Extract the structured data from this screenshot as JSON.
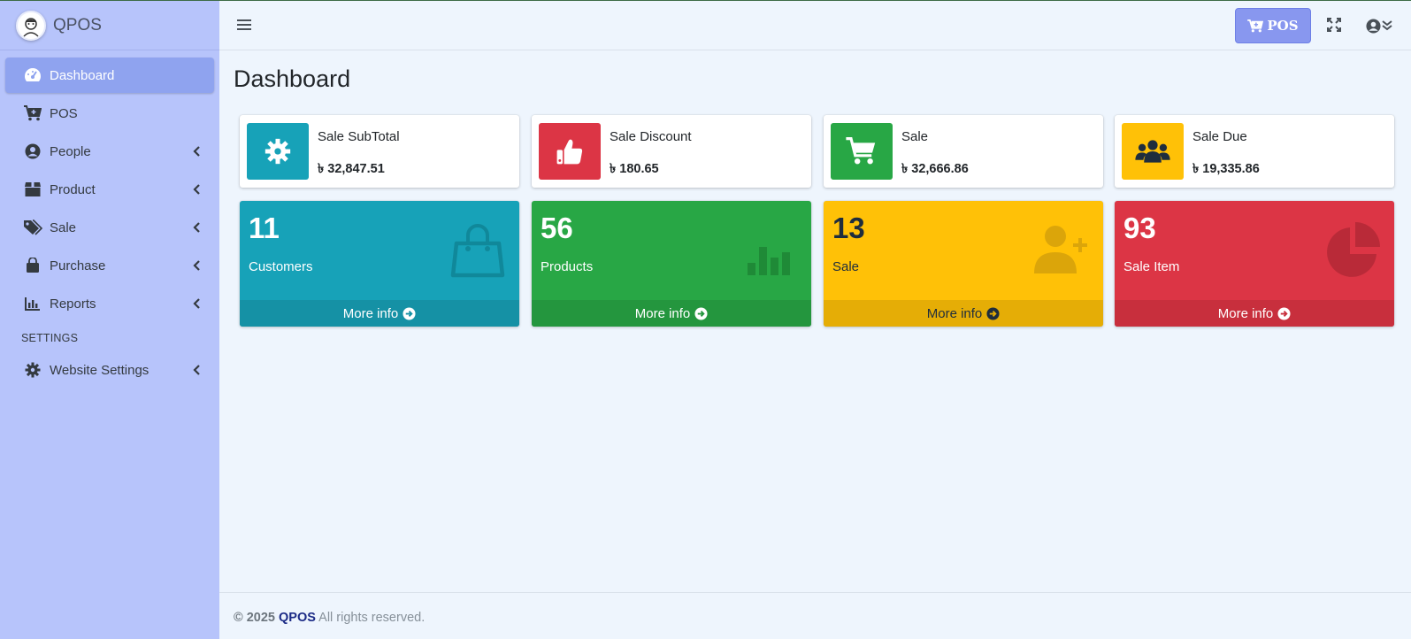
{
  "app": {
    "brand": "QPOS"
  },
  "colors": {
    "sidebar_bg": "#b7c4fb",
    "active_item": "#8fa3ef",
    "info": "#17a2b8",
    "success": "#28a745",
    "warning": "#ffc107",
    "danger": "#dc3545",
    "pos_button": "#8897ef"
  },
  "sidebar": {
    "items": [
      {
        "label": "Dashboard",
        "icon": "tachometer-icon",
        "active": true
      },
      {
        "label": "POS",
        "icon": "cart-plus-icon"
      },
      {
        "label": "People",
        "icon": "user-circle-icon",
        "has_submenu": true
      },
      {
        "label": "Product",
        "icon": "box-icon",
        "has_submenu": true
      },
      {
        "label": "Sale",
        "icon": "tags-icon",
        "has_submenu": true
      },
      {
        "label": "Purchase",
        "icon": "shopping-bag-icon",
        "has_submenu": true
      },
      {
        "label": "Reports",
        "icon": "bar-chart-icon",
        "has_submenu": true
      }
    ],
    "section_header": "SETTINGS",
    "settings_items": [
      {
        "label": "Website Settings",
        "icon": "gear-icon",
        "has_submenu": true
      }
    ]
  },
  "topbar": {
    "pos_button": "POS",
    "icons": [
      "hamburger-icon",
      "expand-icon",
      "user-circle-icon",
      "double-chevron-down-icon"
    ]
  },
  "main": {
    "title": "Dashboard",
    "info_boxes": [
      {
        "label": "Sale SubTotal",
        "value": "৳ 32,847.51",
        "icon": "gear-icon",
        "color": "#17a2b8"
      },
      {
        "label": "Sale Discount",
        "value": "৳ 180.65",
        "icon": "thumbs-up-icon",
        "color": "#dc3545"
      },
      {
        "label": "Sale",
        "value": "৳ 32,666.86",
        "icon": "cart-icon",
        "color": "#28a745"
      },
      {
        "label": "Sale Due",
        "value": "৳ 19,335.86",
        "icon": "users-icon",
        "color": "#ffc107"
      }
    ],
    "small_boxes": [
      {
        "number": "11",
        "label": "Customers",
        "link": "More info",
        "icon": "shopping-bag-icon",
        "color": "#17a2b8"
      },
      {
        "number": "56",
        "label": "Products",
        "link": "More info",
        "icon": "bar-chart-icon",
        "color": "#28a745"
      },
      {
        "number": "13",
        "label": "Sale",
        "link": "More info",
        "icon": "user-plus-icon",
        "color": "#ffc107"
      },
      {
        "number": "93",
        "label": "Sale Item",
        "link": "More info",
        "icon": "pie-chart-icon",
        "color": "#dc3545"
      }
    ]
  },
  "footer": {
    "copyright": "© 2025",
    "brand": "QPOS",
    "rights": "All rights reserved."
  }
}
